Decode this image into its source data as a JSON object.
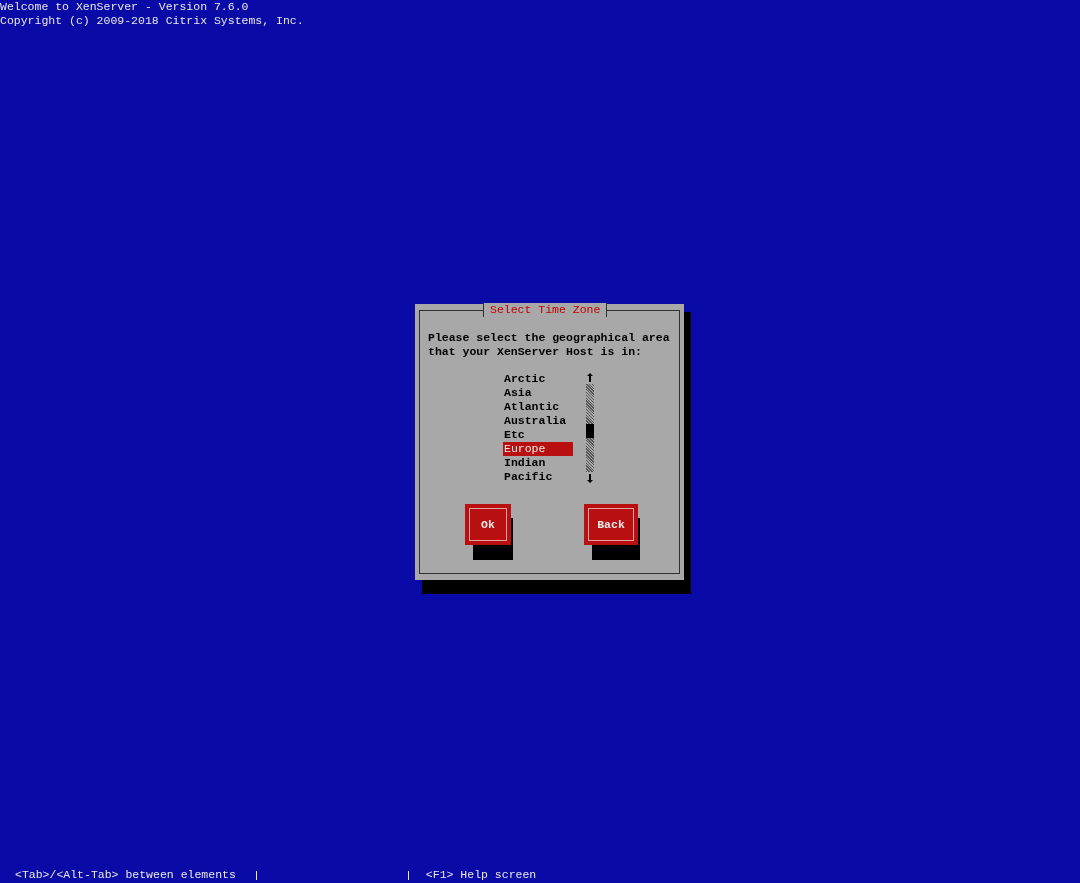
{
  "header": {
    "lines": [
      "Welcome to XenServer - Version 7.6.0",
      "Copyright (c) 2009-2018 Citrix Systems, Inc."
    ]
  },
  "dialog": {
    "title": "Select Time Zone",
    "prompt": "Please select the geographical area that your XenServer Host is in:",
    "items": [
      {
        "label": "Arctic",
        "selected": false
      },
      {
        "label": "Asia",
        "selected": false
      },
      {
        "label": "Atlantic",
        "selected": false
      },
      {
        "label": "Australia",
        "selected": false
      },
      {
        "label": "Etc",
        "selected": false
      },
      {
        "label": "Europe",
        "selected": true
      },
      {
        "label": "Indian",
        "selected": false
      },
      {
        "label": "Pacific",
        "selected": false
      }
    ],
    "buttons": [
      "Ok",
      "Back"
    ]
  },
  "status_bar": [
    "<Tab>/<Alt-Tab> between elements",
    "<F1> Help screen"
  ]
}
